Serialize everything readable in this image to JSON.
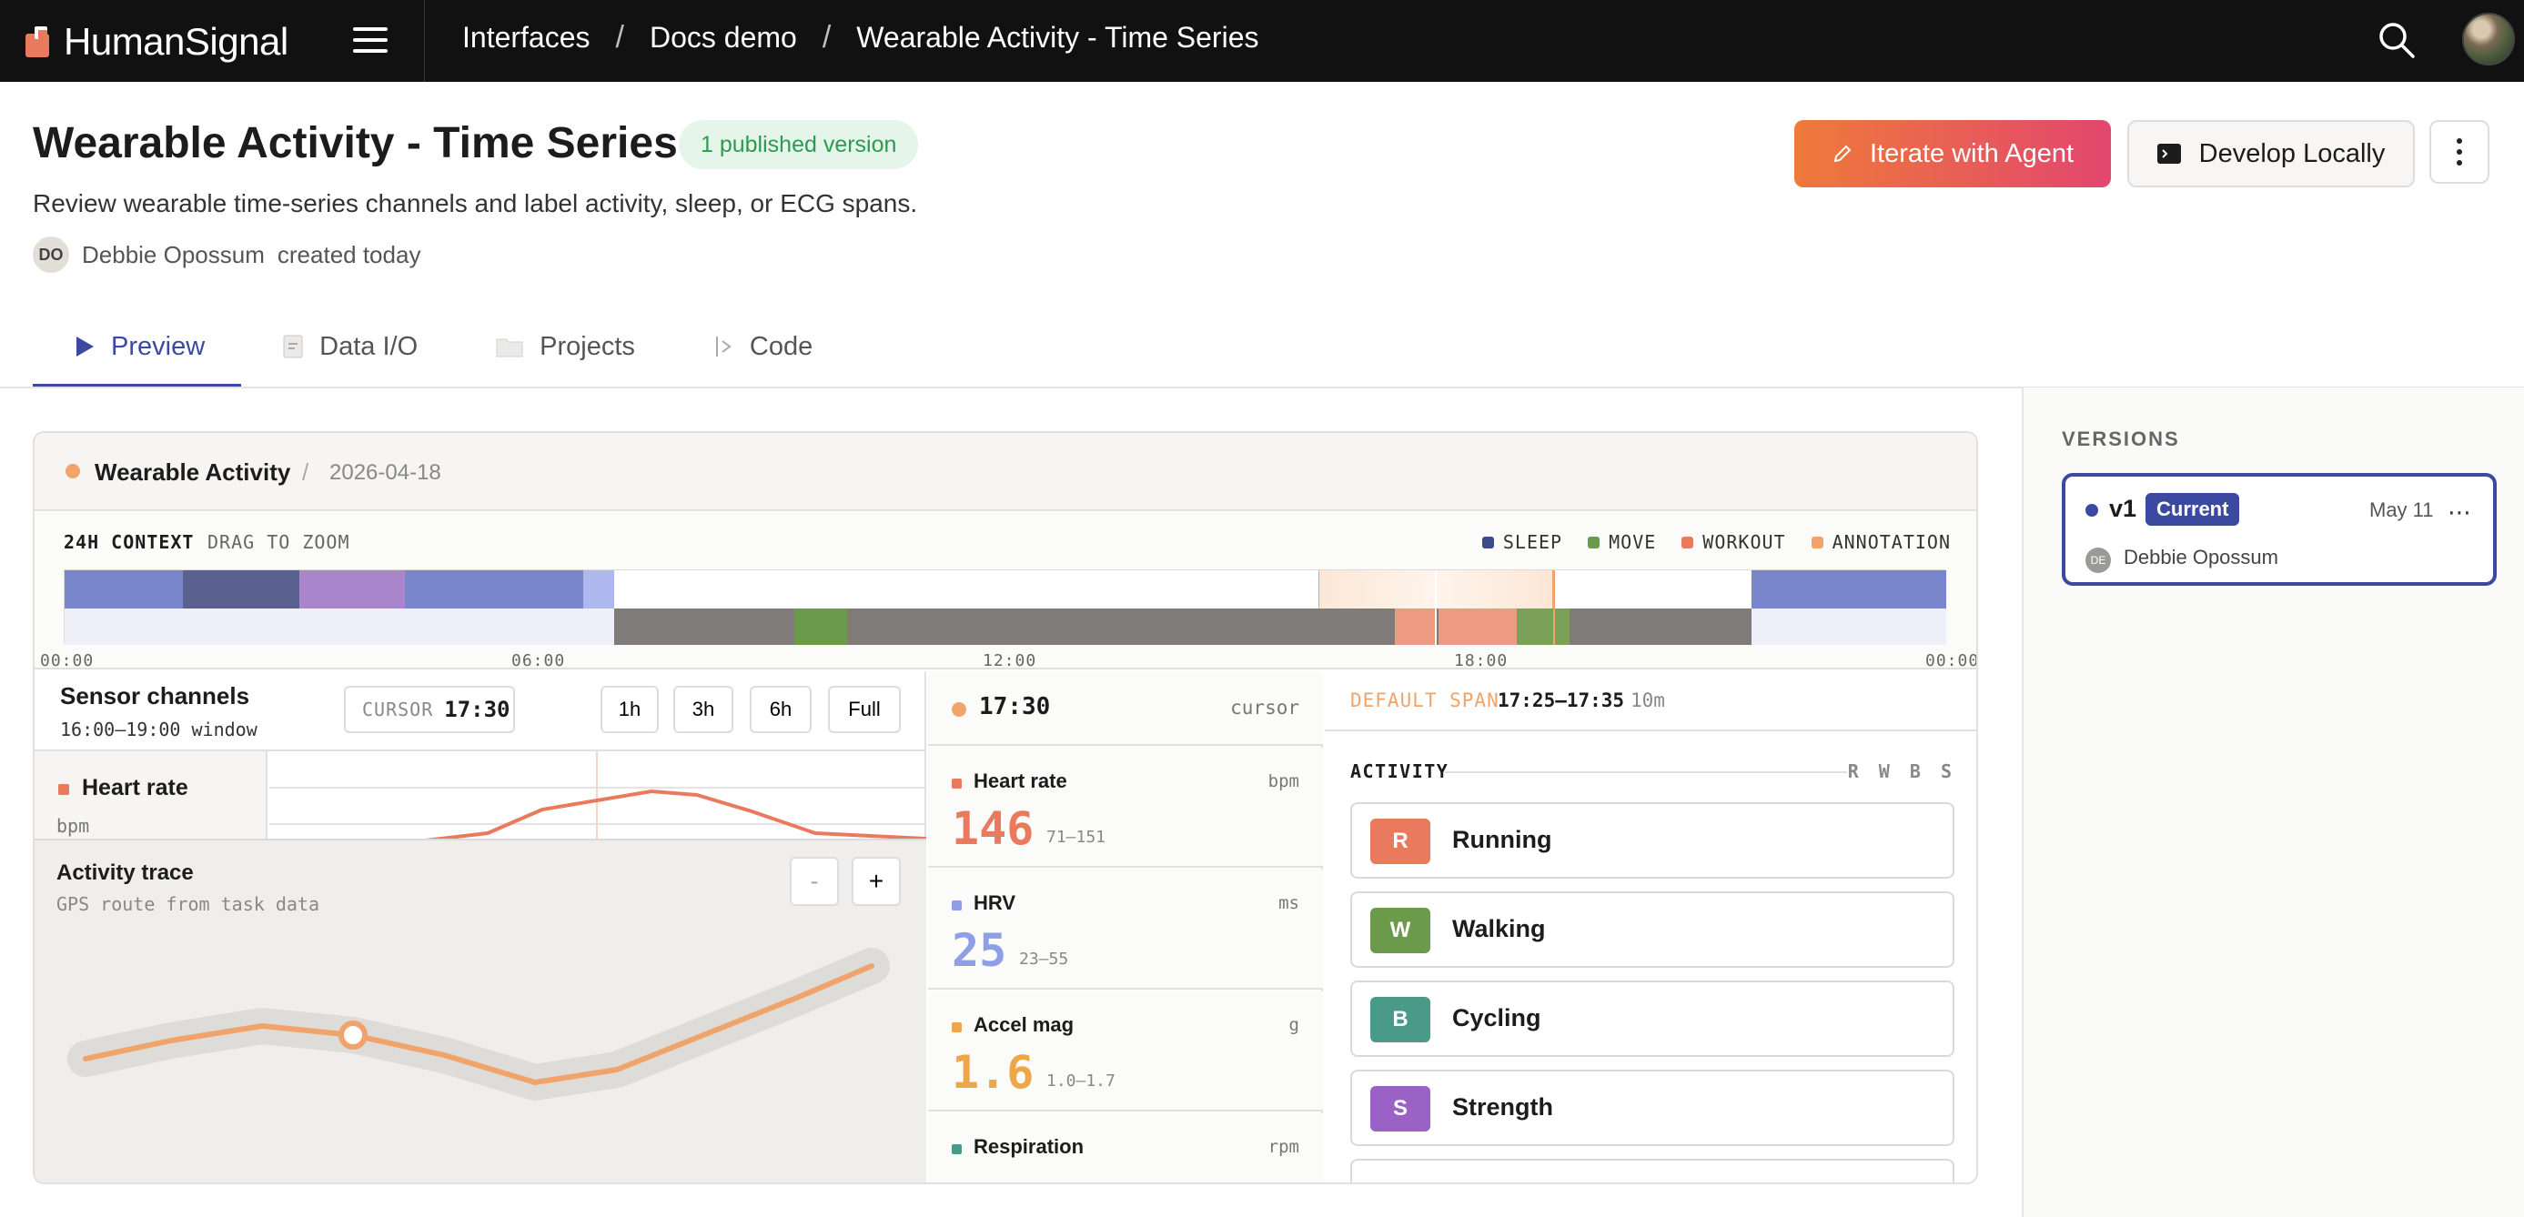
{
  "nav": {
    "logo_text": "HumanSignal",
    "breadcrumbs": [
      "Interfaces",
      "Docs demo",
      "Wearable Activity - Time Series"
    ],
    "separator": "/"
  },
  "header": {
    "title": "Wearable Activity - Time Series",
    "published_badge": "1 published version",
    "description": "Review wearable time-series channels and label activity, sleep, or ECG spans.",
    "creator_initials": "DO",
    "creator_name": "Debbie Opossum",
    "created_text": "created today",
    "iterate_button": "Iterate with Agent",
    "develop_button": "Develop Locally"
  },
  "tabs": [
    {
      "label": "Preview",
      "icon": "play-icon",
      "active": true
    },
    {
      "label": "Data I/O",
      "icon": "document-icon",
      "active": false
    },
    {
      "label": "Projects",
      "icon": "folder-icon",
      "active": false
    },
    {
      "label": "Code",
      "icon": "code-icon",
      "active": false
    }
  ],
  "versions": {
    "heading": "VERSIONS",
    "items": [
      {
        "name": "v1",
        "badge": "Current",
        "date": "May 11",
        "more": "⋯",
        "author_initials": "DE",
        "author": "Debbie Opossum"
      }
    ]
  },
  "preview": {
    "title": "Wearable Activity",
    "separator": "/",
    "date": "2026-04-18",
    "context": {
      "label": "24H CONTEXT",
      "hint": "DRAG TO ZOOM",
      "legend": [
        {
          "label": "SLEEP",
          "color": "#3b4a8a"
        },
        {
          "label": "MOVE",
          "color": "#6a9a4a"
        },
        {
          "label": "WORKOUT",
          "color": "#e97a5e"
        },
        {
          "label": "ANNOTATION",
          "color": "#f0a36a"
        }
      ],
      "ticks": [
        "00:00",
        "06:00",
        "12:00",
        "18:00",
        "00:00"
      ]
    },
    "sensors": {
      "title": "Sensor channels",
      "window": "16:00–19:00 window",
      "cursor_label": "CURSOR",
      "cursor_value": "17:30",
      "ranges": [
        "1h",
        "3h",
        "6h",
        "Full"
      ],
      "channels": [
        {
          "name": "Heart rate",
          "unit": "bpm",
          "color": "#e97a5e"
        }
      ]
    },
    "trace": {
      "title": "Activity trace",
      "subtitle": "GPS route from task data",
      "zoom_out": "-",
      "zoom_in": "+"
    },
    "readouts": {
      "time": "17:30",
      "cursor_label": "cursor",
      "metrics": [
        {
          "name": "Heart rate",
          "unit": "bpm",
          "value": "146",
          "range": "71–151",
          "color": "#e97a5e"
        },
        {
          "name": "HRV",
          "unit": "ms",
          "value": "25",
          "range": "23–55",
          "color": "#8e9fe6"
        },
        {
          "name": "Accel mag",
          "unit": "g",
          "value": "1.6",
          "range": "1.0–1.7",
          "color": "#eea64a"
        },
        {
          "name": "Respiration",
          "unit": "rpm",
          "value": "",
          "range": "",
          "color": "#4a9a8a"
        }
      ]
    },
    "labels": {
      "default_span_label": "DEFAULT SPAN",
      "span": "17:25–17:35",
      "duration": "10m",
      "activity_label": "ACTIVITY",
      "hotkeys": "R W B S",
      "items": [
        {
          "key": "R",
          "name": "Running",
          "color": "#e97a5e"
        },
        {
          "key": "W",
          "name": "Walking",
          "color": "#6a9a4a"
        },
        {
          "key": "B",
          "name": "Cycling",
          "color": "#4a9a8a"
        },
        {
          "key": "S",
          "name": "Strength",
          "color": "#9a62c4"
        }
      ]
    }
  }
}
